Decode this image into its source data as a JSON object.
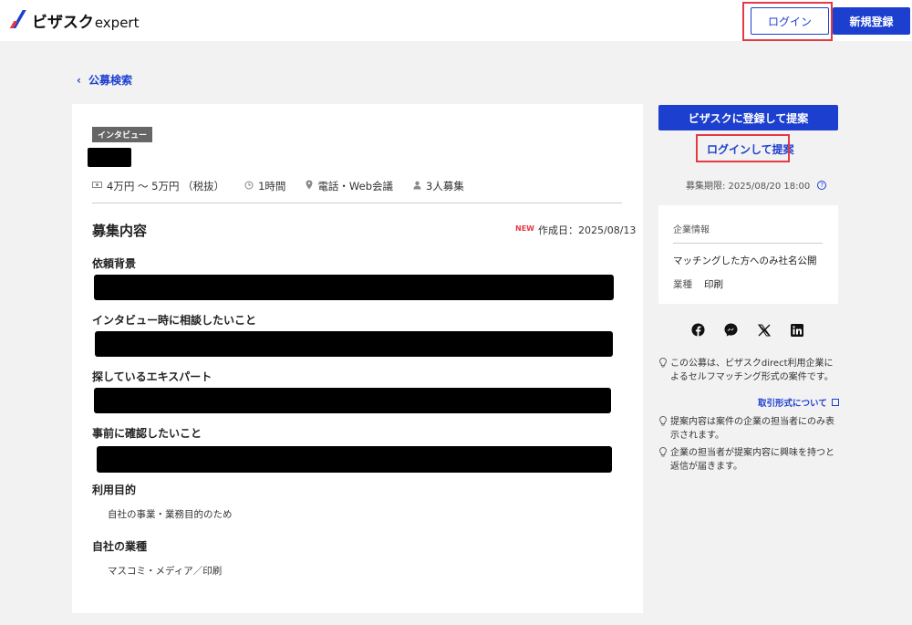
{
  "header": {
    "logo_ja": "ビザスク",
    "logo_en": "expert",
    "login_label": "ログイン",
    "signup_label": "新規登録"
  },
  "back_link": "公募検索",
  "main": {
    "tag": "インタビュー",
    "meta": {
      "fee": "4万円 〜 5万円 （税抜）",
      "duration": "1時間",
      "method": "電話・Web会議",
      "headcount": "3人募集"
    },
    "section_title": "募集内容",
    "new_badge": "NEW",
    "created": "作成日：2025/08/13",
    "fields": [
      {
        "label": "依頼背景"
      },
      {
        "label": "インタビュー時に相談したいこと"
      },
      {
        "label": "探しているエキスパート"
      },
      {
        "label": "事前に確認したいこと"
      },
      {
        "label": "利用目的",
        "value": "自社の事業・業務目的のため"
      },
      {
        "label": "自社の業種",
        "value": "マスコミ・メディア／印刷"
      }
    ]
  },
  "sidebar": {
    "cta_label": "ビザスクに登録して提案",
    "propose_label": "ログインして提案",
    "deadline": "募集期限: 2025/08/20 18:00",
    "company": {
      "heading": "企業情報",
      "public_note": "マッチングした方へのみ社名公開",
      "industry_label": "業種",
      "industry_value": "印刷"
    },
    "social_icons": [
      "facebook-icon",
      "messenger-icon",
      "x-icon",
      "linkedin-icon"
    ],
    "notes": [
      "この公募は、ビザスクdirect利用企業によるセルフマッチング形式の案件です。",
      "提案内容は案件の企業の担当者にのみ表示されます。",
      "企業の担当者が提案内容に興味を持つと返信が届きます。"
    ],
    "trade_link": "取引形式について"
  },
  "colors": {
    "brand_blue": "#1d3fcf",
    "highlight_red": "#e53945",
    "background": "#f2f2f2"
  }
}
